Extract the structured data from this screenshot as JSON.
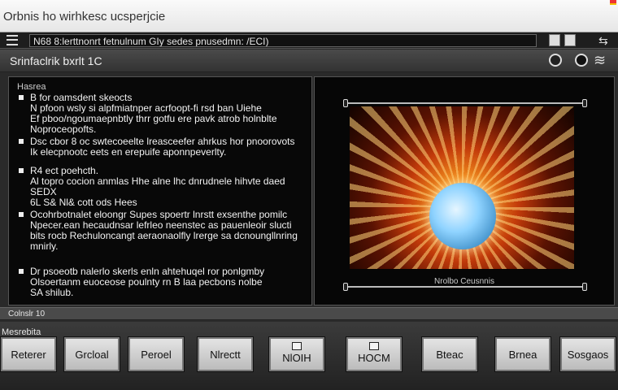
{
  "window": {
    "title": "Orbnis ho wirhkesc ucsperjcie"
  },
  "toolbar": {
    "path": "N68 8:lerttnonrt fetnulnum GIy sedes pnusedmn: /ECI)",
    "share_icon": "share-icon"
  },
  "header": {
    "title": "Srinfaclrik bxrlt 1C"
  },
  "panel_left": {
    "title": "Hasrea",
    "items": [
      {
        "lines": [
          "B for oamsdent skeocts",
          "N pfoon wsly si alpfmiatnper acrfoopt-fi rsd ban Uiehe",
          "Ef pboo/ngoumaepnbtly thrr gotfu ere pavk atrob holnblte",
          "Noproceopofts."
        ]
      },
      {
        "lines": [
          "Dsc cbor 8 oc swtecoeelte lreasceefer ahrkus hor pnoorovots",
          "Ik elecpnootc eets en erepuife aponnpeverlty."
        ]
      },
      {
        "lines": [
          "R4 ect poehcth.",
          "Al topro cocion anmlas Hhe alne lhc dnrudnele hihvte daed SEDX",
          "6L S& Nl& cott ods Hees"
        ]
      },
      {
        "lines": [
          "Ocohrbotnalet eloongr Supes spoertr lnrstt exsenthe pomilc",
          "Npecer.ean hecaudnsar lefrleo neenstec as pauenleoir slucti",
          "bits rocb Rechuloncangt aeraonaolfly lrerge sa dcnoungllnring",
          "mnirly."
        ]
      },
      {
        "lines": [
          "Dr psoeotb nalerlo skerls enln ahtehuqel ror ponlgmby",
          "Olsoertanm euoceose poulnty rn B laa pecbons nolbe",
          "SA shilub."
        ]
      }
    ]
  },
  "preview": {
    "caption": "Nrolbo Ceusnnis"
  },
  "status": {
    "text": "Colnslr 10"
  },
  "controls": {
    "label": "Mesrebita",
    "buttons": [
      {
        "label": "Reterer",
        "icon": null
      },
      {
        "label": "Grcloal",
        "icon": null
      },
      {
        "label": "Peroel",
        "icon": null
      },
      {
        "label": "Nlrectt",
        "icon": null
      },
      {
        "label": "NlOIH",
        "icon": "screen-icon"
      },
      {
        "label": "HOCM",
        "icon": "screen-icon"
      },
      {
        "label": "Bteac",
        "icon": null
      },
      {
        "label": "Brnea",
        "icon": null
      },
      {
        "label": "Sosgaos",
        "icon": null
      }
    ]
  }
}
